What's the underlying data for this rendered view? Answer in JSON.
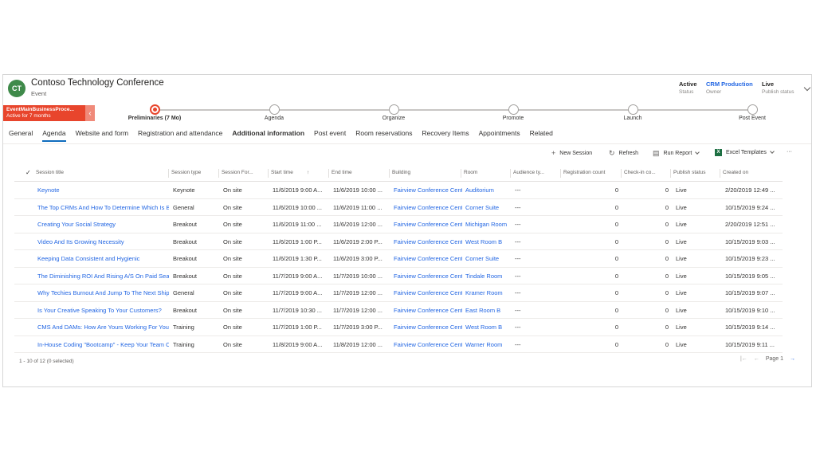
{
  "record": {
    "initials": "CT",
    "title": "Contoso Technology Conference",
    "type": "Event",
    "status_value": "Active",
    "status_label": "Status",
    "owner_value": "CRM Production",
    "owner_label": "Owner",
    "publish_value": "Live",
    "publish_label": "Publish status"
  },
  "bpf": {
    "name": "EventMainBusinessProce...",
    "active_for": "Active for 7 months",
    "stages": [
      "Preliminaries (7 Mo)",
      "Agenda",
      "Organize",
      "Promote",
      "Launch",
      "Post Event"
    ]
  },
  "tabs": [
    "General",
    "Agenda",
    "Website and form",
    "Registration and attendance",
    "Additional information",
    "Post event",
    "Room reservations",
    "Recovery Items",
    "Appointments",
    "Related"
  ],
  "commands": {
    "new_session": "New Session",
    "refresh": "Refresh",
    "run_report": "Run Report",
    "excel_templates": "Excel Templates",
    "more": "···"
  },
  "grid": {
    "columns": [
      "Session title",
      "Session type",
      "Session For...",
      "Start time",
      "End time",
      "Building",
      "Room",
      "Audience ty...",
      "Registration count",
      "Check-in co...",
      "Publish status",
      "Created on"
    ],
    "rows": [
      [
        "Keynote",
        "Keynote",
        "On site",
        "11/6/2019 9:00 A...",
        "11/6/2019 10:00 ...",
        "Fairview Conference Cente",
        "Auditorium",
        "---",
        "0",
        "0",
        "Live",
        "2/20/2019 12:49 ..."
      ],
      [
        "The Top CRMs And How To Determine Which Is Be",
        "General",
        "On site",
        "11/6/2019 10:00 ...",
        "11/6/2019 11:00 ...",
        "Fairview Conference Cente",
        "Corner Suite",
        "---",
        "0",
        "0",
        "Live",
        "10/15/2019 9:24 ..."
      ],
      [
        "Creating Your Social Strategy",
        "Breakout",
        "On site",
        "11/6/2019 11:00 ...",
        "11/6/2019 12:00 ...",
        "Fairview Conference Cente",
        "Michigan Room",
        "---",
        "0",
        "0",
        "Live",
        "2/20/2019 12:51 ..."
      ],
      [
        "Video And Its Growing Necessity",
        "Breakout",
        "On site",
        "11/6/2019 1:00 P...",
        "11/6/2019 2:00 P...",
        "Fairview Conference Cente",
        "West Room B",
        "---",
        "0",
        "0",
        "Live",
        "10/15/2019 9:03 ..."
      ],
      [
        "Keeping Data Consistent and Hygienic",
        "Breakout",
        "On site",
        "11/6/2019 1:30 P...",
        "11/6/2019 3:00 P...",
        "Fairview Conference Cente",
        "Corner Suite",
        "---",
        "0",
        "0",
        "Live",
        "10/15/2019 9:23 ..."
      ],
      [
        "The Diminishing ROI And Rising A/S On Paid Searc",
        "Breakout",
        "On site",
        "11/7/2019 9:00 A...",
        "11/7/2019 10:00 ...",
        "Fairview Conference Cente",
        "Tindale Room",
        "---",
        "0",
        "0",
        "Live",
        "10/15/2019 9:05 ..."
      ],
      [
        "Why Techies Burnout And Jump To The Next Ship...",
        "General",
        "On site",
        "11/7/2019 9:00 A...",
        "11/7/2019 12:00 ...",
        "Fairview Conference Cente",
        "Kramer Room",
        "---",
        "0",
        "0",
        "Live",
        "10/15/2019 9:07 ..."
      ],
      [
        "Is Your Creative Speaking To Your Customers?",
        "Breakout",
        "On site",
        "11/7/2019 10:30 ...",
        "11/7/2019 12:00 ...",
        "Fairview Conference Cente",
        "East Room B",
        "---",
        "0",
        "0",
        "Live",
        "10/15/2019 9:10 ..."
      ],
      [
        "CMS And DAMs: How Are Yours Working For You?",
        "Training",
        "On site",
        "11/7/2019 1:00 P...",
        "11/7/2019 3:00 P...",
        "Fairview Conference Cente",
        "West Room B",
        "---",
        "0",
        "0",
        "Live",
        "10/15/2019 9:14 ..."
      ],
      [
        "In-House Coding \"Bootcamp\" - Keep Your Team O",
        "Training",
        "On site",
        "11/8/2019 9:00 A...",
        "11/8/2019 12:00 ...",
        "Fairview Conference Cente",
        "Warner Room",
        "---",
        "0",
        "0",
        "Live",
        "10/15/2019 9:11 ..."
      ]
    ],
    "count_text": "1 - 10 of 12 (0 selected)",
    "page_label": "Page 1"
  }
}
